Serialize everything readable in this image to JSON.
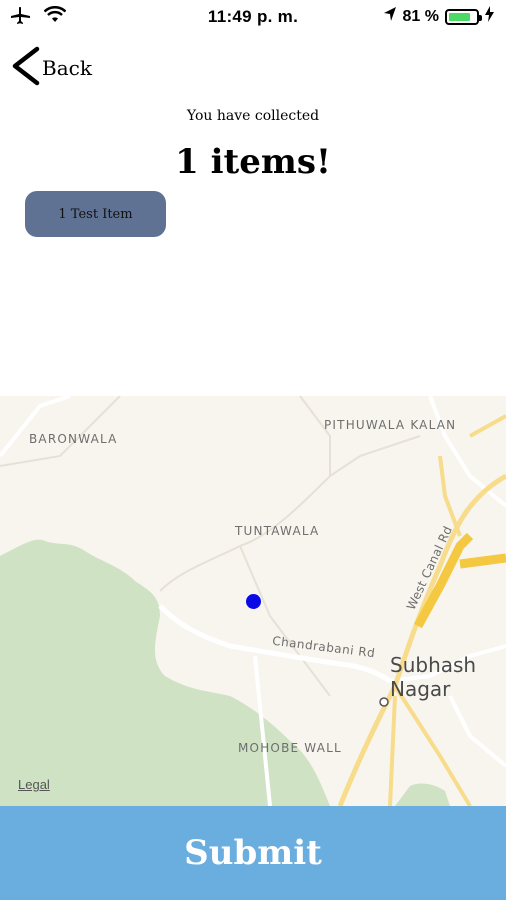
{
  "status_bar": {
    "time": "11:49 p. m.",
    "battery_percent": "81 %",
    "battery_level": 0.81,
    "icons": [
      "airplane-icon",
      "wifi-icon",
      "location-arrow-icon",
      "battery-icon",
      "charging-bolt-icon"
    ]
  },
  "nav": {
    "back_label": "Back"
  },
  "summary": {
    "label": "You have collected",
    "count_text": "1 items!"
  },
  "items": [
    {
      "label": "1 Test Item"
    }
  ],
  "map": {
    "labels": {
      "baronwala": "BARONWALA",
      "pithuwala": "PITHUWALA KALAN",
      "tuntawala": "TUNTAWALA",
      "chandrabani": "Chandrabani Rd",
      "west_canal": "West Canal Rd",
      "subhash": "Subhash",
      "nagar": "Nagar",
      "mohobe": "MOHOBE WALL"
    },
    "legal": "Legal",
    "colors": {
      "background": "#f8f5ee",
      "forest": "#cfe3c4",
      "highway": "#f5c842",
      "road": "#ffffff",
      "pin": "#0a0ae6"
    }
  },
  "submit_label": "Submit",
  "colors": {
    "chip": "#607293",
    "submit": "#6aaee0"
  }
}
